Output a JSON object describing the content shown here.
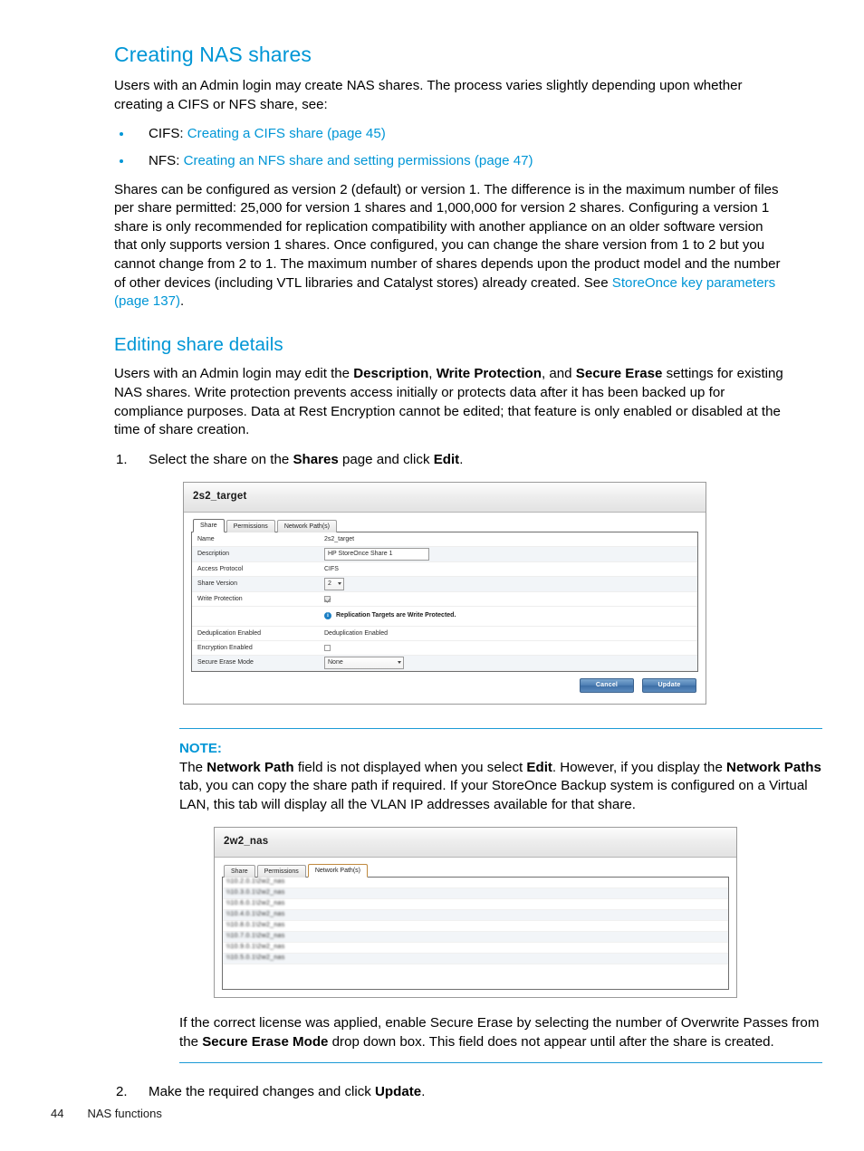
{
  "page": {
    "footer_page_number": "44",
    "footer_chapter": "NAS functions"
  },
  "sections": {
    "creating": {
      "heading": "Creating NAS shares",
      "intro": "Users with an Admin login may create NAS shares. The process varies slightly depending upon whether creating a CIFS or NFS share, see:",
      "bullets": [
        {
          "prefix": "CIFS: ",
          "link": "Creating a CIFS share (page 45)"
        },
        {
          "prefix": "NFS: ",
          "link": "Creating an NFS share and setting permissions (page 47)"
        }
      ],
      "para_pre_link": "Shares can be configured as version 2 (default) or version 1. The difference is in the maximum number of files per share permitted: 25,000 for version 1 shares and 1,000,000 for version 2 shares. Configuring a version 1 share is only recommended for replication compatibility with another appliance on an older software version that only supports version 1 shares. Once configured, you can change the share version from 1 to 2 but you cannot change from 2 to 1. The maximum number of shares depends upon the product model and the number of other devices (including VTL libraries and Catalyst stores) already created. See ",
      "para_link": "StoreOnce key parameters (page 137)",
      "para_post_link": "."
    },
    "editing": {
      "heading": "Editing share details",
      "para1_a": "Users with an Admin login may edit the ",
      "para1_b1": "Description",
      "para1_c": ", ",
      "para1_b2": "Write Protection",
      "para1_d": ", and ",
      "para1_b3": "Secure Erase",
      "para1_e": " settings for existing NAS shares. Write protection prevents access initially or protects data after it has been backed up for compliance purposes. Data at Rest Encryption cannot be edited; that feature is only enabled or disabled at the time of share creation.",
      "step1_num": "1.",
      "step1_a": "Select the share on the ",
      "step1_b1": "Shares",
      "step1_c": " page and click ",
      "step1_b2": "Edit",
      "step1_d": ".",
      "step2_num": "2.",
      "step2_a": "Make the required changes and click ",
      "step2_b1": "Update",
      "step2_c": "."
    },
    "note": {
      "label": "NOTE:",
      "a": "The ",
      "b1": "Network Path",
      "c": " field is not displayed when you select ",
      "b2": "Edit",
      "d": ". However, if you display the ",
      "b3": "Network Paths",
      "e": " tab, you can copy the share path if required. If your StoreOnce Backup system is configured on a Virtual LAN, this tab will display all the VLAN IP addresses available for that share.",
      "f_a": "If the correct license was applied, enable Secure Erase by selecting the number of Overwrite Passes from the ",
      "f_b1": "Secure Erase Mode",
      "f_c": " drop down box. This field does not appear until after the share is created."
    }
  },
  "figure_edit_share": {
    "title": "2s2_target",
    "tabs": [
      {
        "label": "Share",
        "state": "active"
      },
      {
        "label": "Permissions",
        "state": "inactive"
      },
      {
        "label": "Network Path(s)",
        "state": "inactive"
      }
    ],
    "rows": [
      {
        "label": "Name",
        "type": "text",
        "value": "2s2_target"
      },
      {
        "label": "Description",
        "type": "input",
        "value": "HP StoreOnce Share 1"
      },
      {
        "label": "Access Protocol",
        "type": "text",
        "value": "CIFS"
      },
      {
        "label": "Share Version",
        "type": "select-small",
        "value": "2"
      },
      {
        "label": "Write Protection",
        "type": "checkbox-checked",
        "value": ""
      },
      {
        "label": "Deduplication Enabled",
        "type": "text",
        "value": "Deduplication Enabled"
      },
      {
        "label": "Encryption Enabled",
        "type": "checkbox",
        "value": ""
      },
      {
        "label": "Secure Erase Mode",
        "type": "select-wide",
        "value": "None"
      }
    ],
    "info_note": "Replication Targets are Write Protected.",
    "info_icon_glyph": "i",
    "buttons": [
      {
        "label": "Cancel"
      },
      {
        "label": "Update"
      }
    ]
  },
  "figure_network_paths": {
    "title": "2w2_nas",
    "tabs": [
      {
        "label": "Share",
        "state": "inactive"
      },
      {
        "label": "Permissions",
        "state": "inactive"
      },
      {
        "label": "Network Path(s)",
        "state": "active"
      }
    ],
    "paths": [
      "\\\\10.2.0.1\\2w2_nas",
      "\\\\10.3.0.1\\2w2_nas",
      "\\\\10.6.0.1\\2w2_nas",
      "\\\\10.4.0.1\\2w2_nas",
      "\\\\10.8.0.1\\2w2_nas",
      "\\\\10.7.0.1\\2w2_nas",
      "\\\\10.9.0.1\\2w2_nas",
      "\\\\10.5.0.1\\2w2_nas"
    ]
  },
  "colors": {
    "accent_blue": "#0096d6",
    "rule_blue": "#1b9ad6",
    "text": "#000000",
    "ui_button_blue": "#4f80b5"
  }
}
